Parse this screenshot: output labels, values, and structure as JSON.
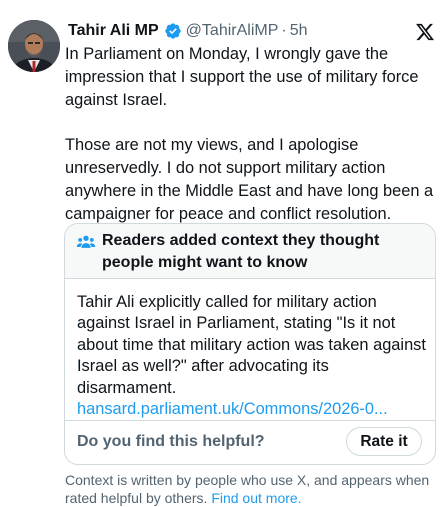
{
  "author": {
    "name": "Tahir Ali MP",
    "handle": "@TahirAliMP",
    "separator": "·",
    "time": "5h"
  },
  "icons": {
    "verified": "verified-badge-icon",
    "platform": "x-logo-icon",
    "note": "people-icon"
  },
  "tweet": {
    "paragraphs": [
      "In Parliament on Monday, I wrongly gave the impression that I support the use of military force against Israel.",
      "Those are not my views, and I apologise unreservedly. I do not support military action anywhere in the Middle East and have long been a campaigner for peace and conflict resolution."
    ]
  },
  "note": {
    "title": "Readers added context they thought people might want to know",
    "body": "Tahir Ali explicitly called for military action against Israel in Parliament, stating \"Is it not about time that military action was taken against Israel as well?\" after advocating its disarmament.",
    "link": "hansard.parliament.uk/Commons/2026-0...",
    "helpful_prompt": "Do you find this helpful?",
    "rate_label": "Rate it"
  },
  "footer": {
    "text": "Context is written by people who use X, and appears when rated helpful by others.",
    "link": "Find out more."
  },
  "colors": {
    "text": "#0f1419",
    "secondary": "#536471",
    "link": "#1d9bf0",
    "border": "#cfd9de",
    "verified": "#1d9bf0",
    "note_header_bg": "#f7f9f9"
  }
}
